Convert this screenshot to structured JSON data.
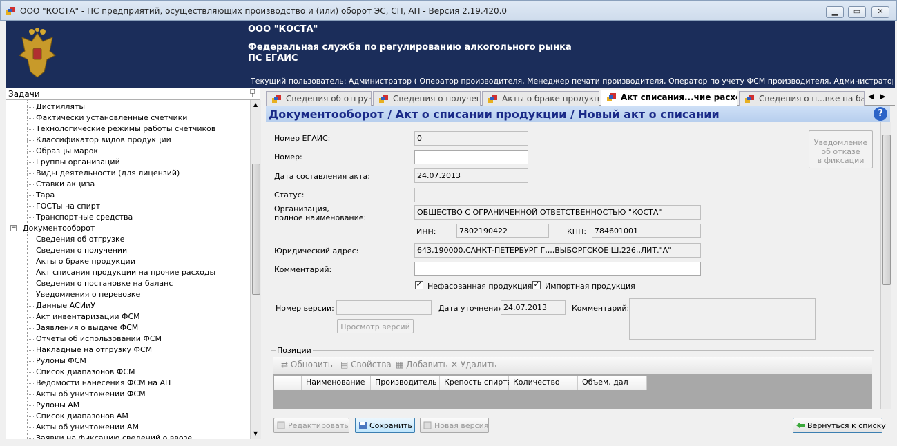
{
  "window": {
    "title": "ООО \"КОСТА\" - ПС предприятий, осуществляющих производство и (или) оборот ЭС, СП, АП - Версия 2.19.420.0",
    "minimize": "▁",
    "maximize": "▭",
    "close": "✕"
  },
  "header": {
    "org": "ООО \"КОСТА\"",
    "agency": "Федеральная служба по регулированию алкогольного рынка",
    "system": "ПС ЕГАИС",
    "current_user": "Текущий пользователь: Администратор ( Оператор производителя, Менеджер печати производителя, Оператор по учету ФСМ производителя, Администратор производителя, Оп..."
  },
  "tasks": {
    "title": "Задачи",
    "pin": "ф",
    "items_top": [
      "Дистилляты",
      "Фактически установленные счетчики",
      "Технологические режимы работы счетчиков",
      "Классификатор видов продукции",
      "Образцы марок",
      "Группы организаций",
      "Виды деятельности (для лицензий)",
      "Ставки акциза",
      "Тара",
      "ГОСТы на спирт",
      "Транспортные средства"
    ],
    "group": "Документооборот",
    "group_toggle": "−",
    "items_doc": [
      "Сведения об отгрузке",
      "Сведения о получении",
      "Акты о браке продукции",
      "Акт списания продукции на прочие расходы",
      "Сведения о постановке на баланс",
      "Уведомления о перевозке",
      "Данные АСИиУ",
      "Акт инвентаризации ФСМ",
      "Заявления о выдаче ФСМ",
      "Отчеты об использовании ФСМ",
      "Накладные на отгрузку ФСМ",
      "Рулоны ФСМ",
      "Список диапазонов ФСМ",
      "Ведомости нанесения ФСМ на АП",
      "Акты об уничтожении ФСМ",
      "Рулоны АМ",
      "Список диапазонов АМ",
      "Акты об уничтожении АМ",
      "Заявки на фиксацию сведений о ввозе"
    ]
  },
  "tabs": [
    "Сведения об отгрузке",
    "Сведения о получении",
    "Акты о браке продукции",
    "Акт списания...чие расходы",
    "Сведения о п...вке на ба"
  ],
  "tab_arrows": [
    "◀",
    "▶"
  ],
  "doc_title": "Документооборот / Акт о списании продукции / Новый акт о списании",
  "help": "?",
  "form": {
    "egais_label": "Номер ЕГАИС:",
    "egais_value": "0",
    "number_label": "Номер:",
    "number_value": "",
    "date_label": "Дата составления акта:",
    "date_value": "24.07.2013",
    "status_label": "Статус:",
    "status_value": "",
    "org_label_1": "Организация,",
    "org_label_2": "полное наименование:",
    "org_value": "ОБЩЕСТВО С ОГРАНИЧЕННОЙ ОТВЕТСТВЕННОСТЬЮ \"КОСТА\"",
    "inn_label": "ИНН:",
    "inn_value": "7802190422",
    "kpp_label": "КПП:",
    "kpp_value": "784601001",
    "address_label": "Юридический адрес:",
    "address_value": "643,190000,САНКТ-ПЕТЕРБУРГ Г,,,,ВЫБОРГСКОЕ Ш,226,,ЛИТ.\"А\"",
    "comment_label": "Комментарий:",
    "comment_value": "",
    "unpacked_label": "Нефасованная продукция",
    "unpacked_checked": "✓",
    "import_label": "Импортная продукция",
    "import_checked": "✓",
    "version_label": "Номер версии:",
    "version_value": "",
    "clarify_label": "Дата уточнения:",
    "clarify_value": "24.07.2013",
    "comment2_label": "Комментарий:",
    "view_versions": "Просмотр версий",
    "notify_line1": "Уведомление",
    "notify_line2": "об отказе",
    "notify_line3": "в фиксации"
  },
  "positions": {
    "title": "Позиции",
    "toolbar": {
      "refresh": "Обновить",
      "properties": "Свойства",
      "add": "Добавить",
      "delete": "Удалить"
    },
    "columns": [
      "Наименование",
      "Производитель",
      "Крепость спирта",
      "Количество",
      "Объем, дал"
    ]
  },
  "buttons": {
    "edit": "Редактировать",
    "save": "Сохранить",
    "new_version": "Новая версия",
    "back": "Вернуться к списку"
  }
}
